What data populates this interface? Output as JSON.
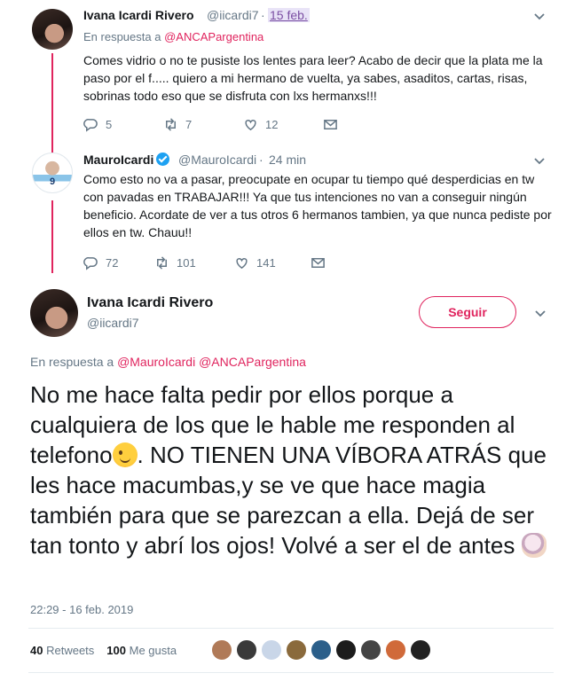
{
  "tweet1": {
    "name": "Ivana Icardi Rivero",
    "handle": "@iicardi7",
    "date": "15 feb.",
    "reply_prefix": "En respuesta a",
    "reply_mentions": "@ANCAPargentina",
    "text": "Comes vidrio o no te pusiste los lentes para leer? Acabo de decir que la plata me la paso por el f..... quiero a mi hermano de vuelta, ya sabes, asaditos, cartas, risas, sobrinas todo eso que se disfruta con lxs hermanxs!!!",
    "replies": "5",
    "retweets": "7",
    "likes": "12"
  },
  "tweet2": {
    "name": "MauroIcardi",
    "handle": "@MauroIcardi",
    "separator": "·",
    "date": "24 min",
    "avatar_number": "9",
    "text": "Como esto no va a pasar, preocupate en ocupar tu tiempo qué desperdicias en tw con pavadas en TRABAJAR!!! Ya que tus intenciones no van a conseguir ningún beneficio. Acordate de ver a tus otros 6 hermanos tambien, ya que nunca pediste por ellos en tw. Chauu!!",
    "replies": "72",
    "retweets": "101",
    "likes": "141"
  },
  "main": {
    "name": "Ivana Icardi Rivero",
    "handle": "@iicardi7",
    "follow_label": "Seguir",
    "reply_prefix": "En respuesta a",
    "reply_mentions": "@MauroIcardi @ANCAPargentina",
    "text_part1": "No me hace falta pedir por ellos porque a cualquiera de los que le hable me responden al telefono",
    "text_part2": ". NO TIENEN UNA VÍBORA ATRÁS que les hace macumbas,y se ve que hace magia también para que se parezcan a ella. Dejá de ser tan tonto y abrí los ojos! Volvé a ser el de antes",
    "timestamp": "22:29 - 16 feb. 2019",
    "retweets_count": "40",
    "retweets_label": "Retweets",
    "likes_count": "100",
    "likes_label": "Me gusta"
  },
  "icons": {
    "reply": "reply-icon",
    "retweet": "retweet-icon",
    "like": "heart-icon",
    "dm": "envelope-icon",
    "caret": "chevron-down-icon",
    "verified": "verified-badge-icon"
  },
  "colors": {
    "accent": "#e0245e",
    "secondary_text": "#657786",
    "verified": "#1da1f2"
  },
  "likers": [
    "#b07a58",
    "#3a3a3a",
    "#c9d6e8",
    "#8a6a3c",
    "#2b5f8a",
    "#1c1c1c",
    "#444444",
    "#d06a3a",
    "#222222"
  ]
}
